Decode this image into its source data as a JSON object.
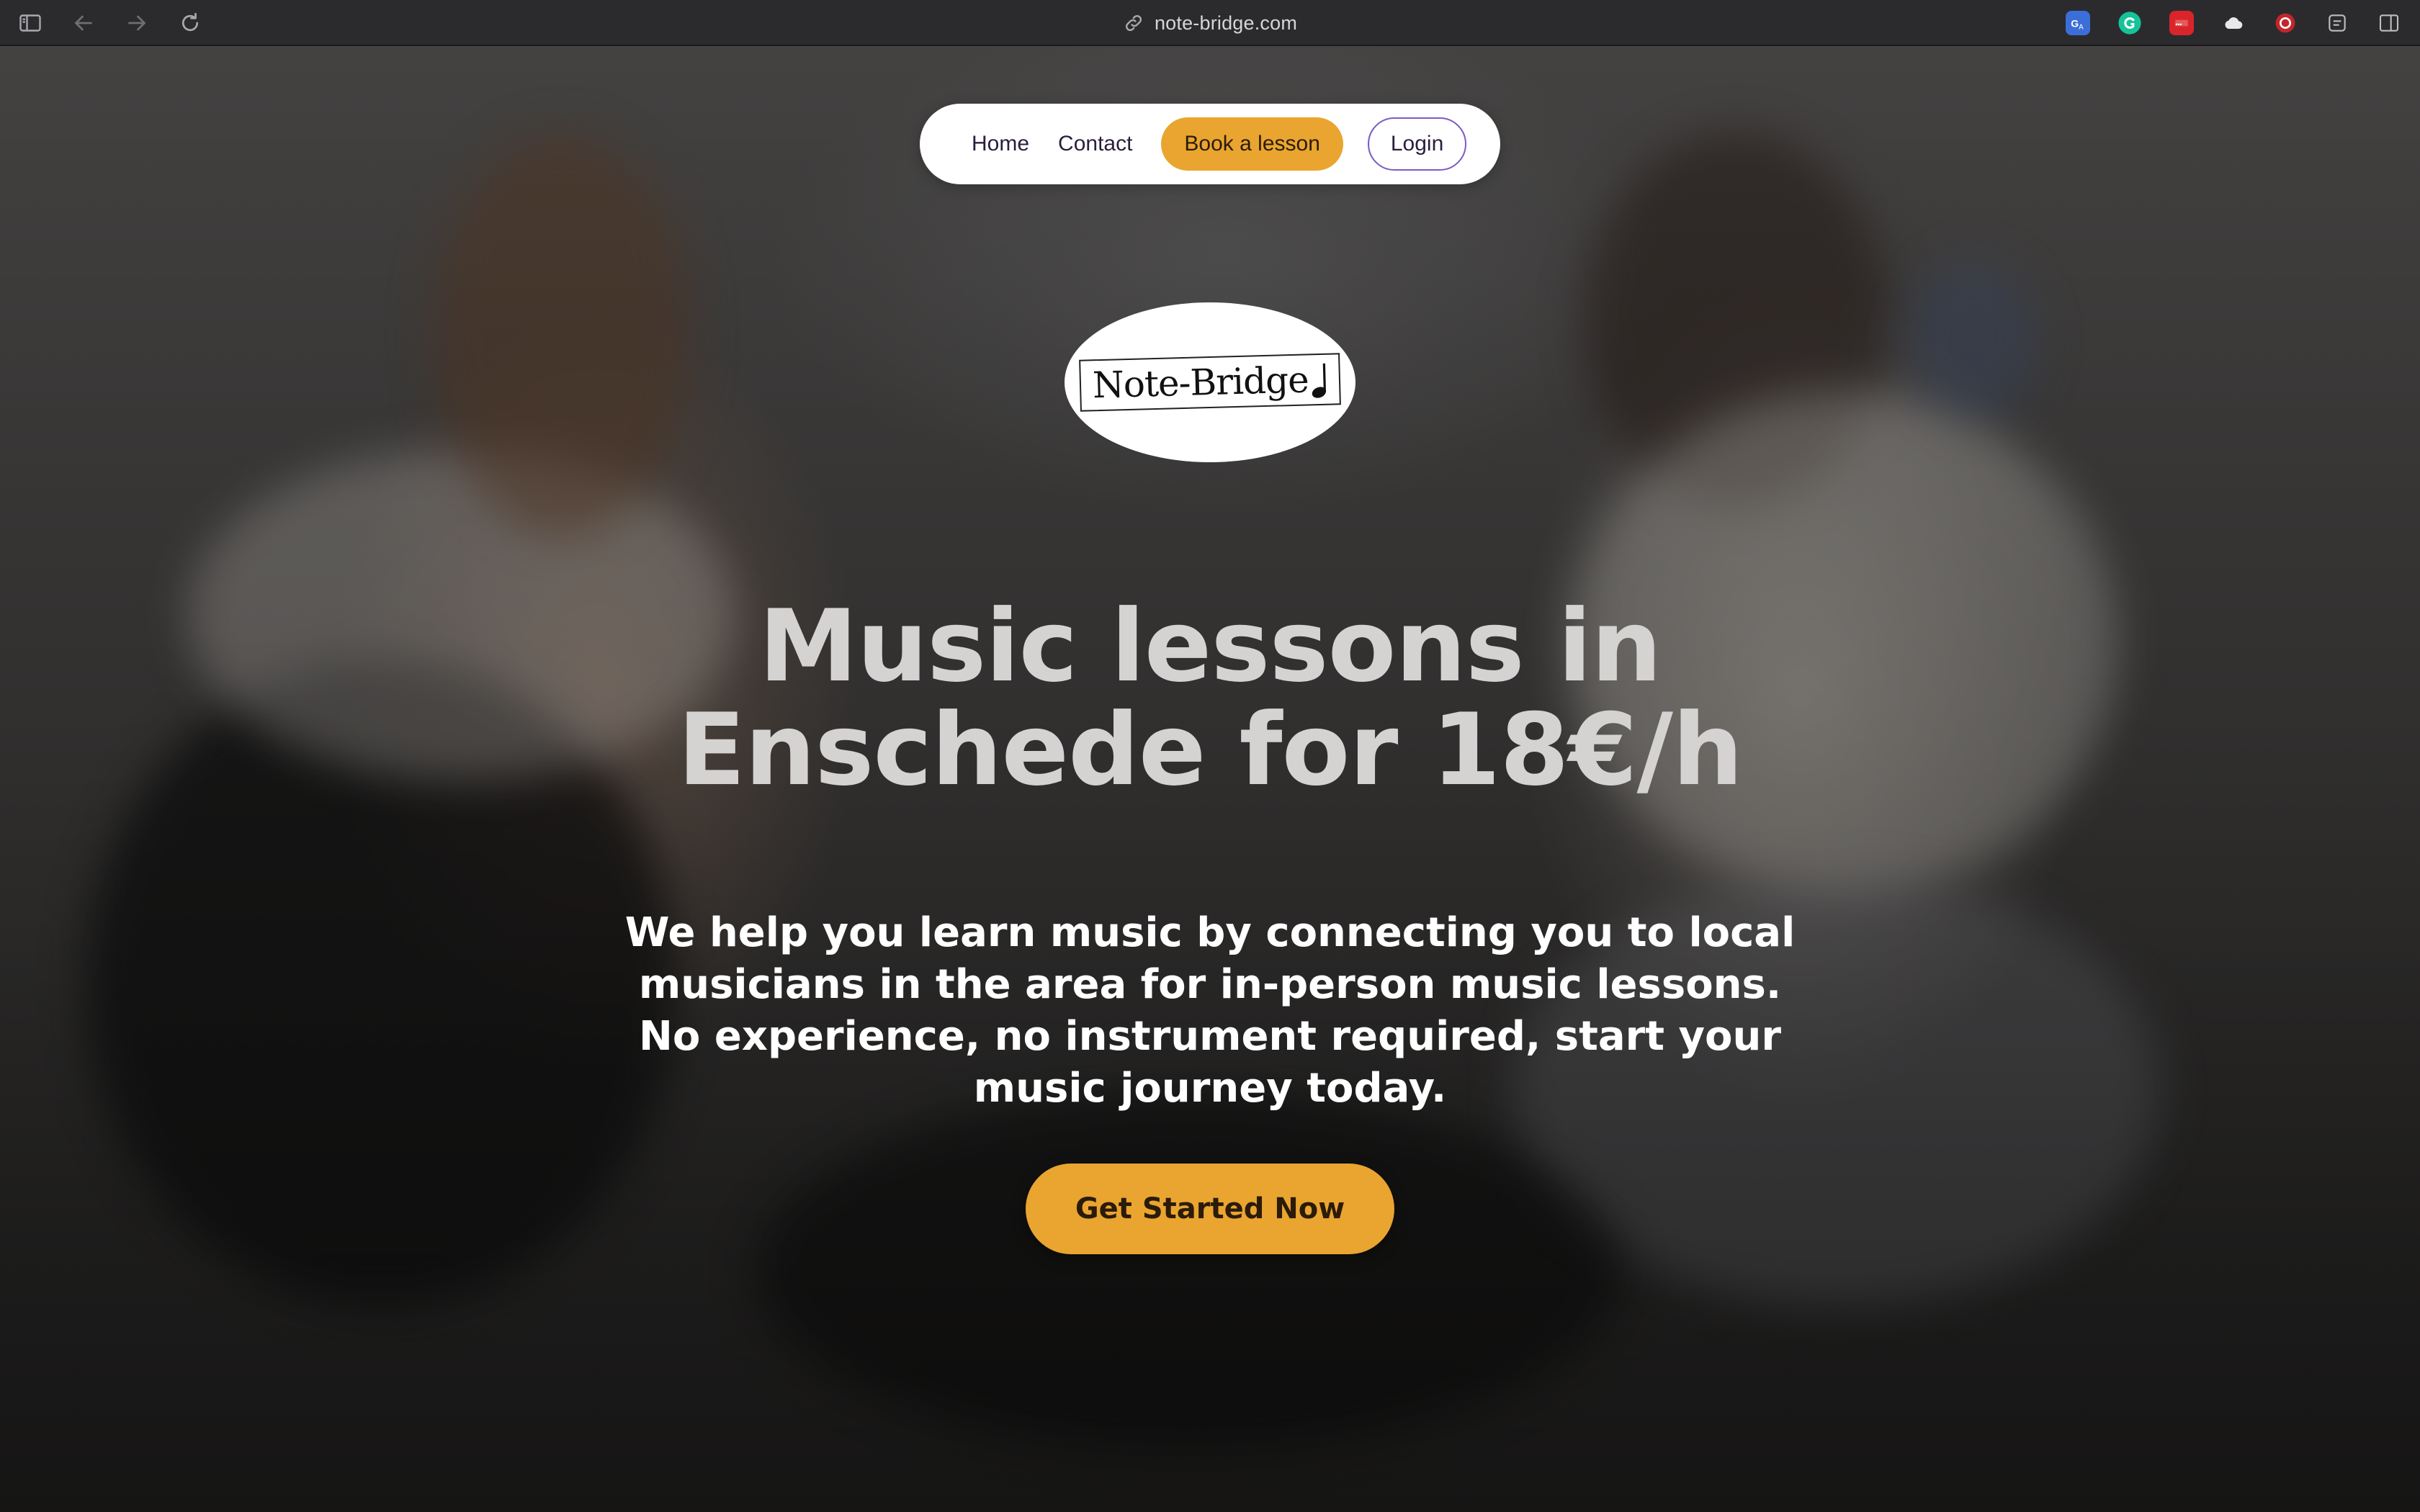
{
  "browser": {
    "url": "note-bridge.com",
    "toolbar_icons": [
      "sidebar-icon",
      "back-arrow-icon",
      "forward-arrow-icon",
      "reload-icon"
    ],
    "extensions": [
      {
        "name": "translate-extension-icon",
        "color": "#3b6ed8"
      },
      {
        "name": "grammarly-extension-icon",
        "color": "#15c39a"
      },
      {
        "name": "red-extension-icon",
        "color": "#d9252a"
      },
      {
        "name": "cloud-extension-icon",
        "color": "#e8e8ea"
      },
      {
        "name": "shield-extension-icon",
        "color": "#c2262b"
      },
      {
        "name": "reader-extension-icon",
        "color": "#bdbdc0"
      },
      {
        "name": "split-view-icon",
        "color": "#bdbdc0"
      }
    ]
  },
  "nav": {
    "home": "Home",
    "contact": "Contact",
    "book": "Book a lesson",
    "login": "Login"
  },
  "logo": {
    "text": "Note-Bridge"
  },
  "hero": {
    "headline_line1": "Music lessons in",
    "headline_line2": "Enschede for 18€/h",
    "subheading": "We help you learn music by connecting you to local musicians in the area for in-person music lessons. No experience, no instrument required, start your music journey today.",
    "cta": "Get Started Now"
  },
  "colors": {
    "accent": "#e9a52f",
    "login_border": "#7b5cc4",
    "headline": "#d4d3d1"
  }
}
